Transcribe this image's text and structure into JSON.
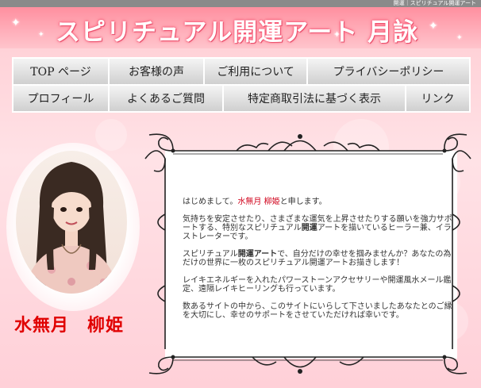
{
  "top_strip": {
    "text": "開運｜スピリチュアル開運アート"
  },
  "banner": {
    "title": "スピリチュアル開運アート  月詠"
  },
  "nav": {
    "row1": [
      "TOP ページ",
      "お客様の声",
      "ご利用について",
      "プライバシーポリシー"
    ],
    "row2": [
      "プロフィール",
      "よくあるご質問",
      "特定商取引法に基づく表示",
      "リンク"
    ]
  },
  "profile": {
    "name": "水無月　柳姫"
  },
  "intro": {
    "p1_a": "はじめまして。",
    "p1_name": "水無月 柳姫",
    "p1_b": "と申します。",
    "p2_a": "気持ちを安定させたり、さまざまな運気を上昇させたりする願いを強力サポートする、特別なスピリチュアル",
    "p2_bold": "開運",
    "p2_b": "アートを描いているヒーラー兼、イラストレーターです。",
    "p3_a": "スピリチュアル",
    "p3_bold": "開運アート",
    "p3_b": "で、自分だけの幸せを掴みませんか？あなたの為だけの世界に一枚のスピリチュアル開運アートお描きします！",
    "p4": "レイキエネルギーを入れたパワーストーンアクセサリーや開運風水メール鑑定、遠隔レイキヒーリングも行っています。",
    "p5": "数あるサイトの中から、このサイトにいらして下さいましたあなたとのご縁を大切にし、幸せのサポートをさせていただければ幸いです。"
  },
  "colors": {
    "banner": "#ff8f9f",
    "name": "#e00000",
    "accent_red": "#d0021b",
    "nav": "#e2e2e2"
  }
}
